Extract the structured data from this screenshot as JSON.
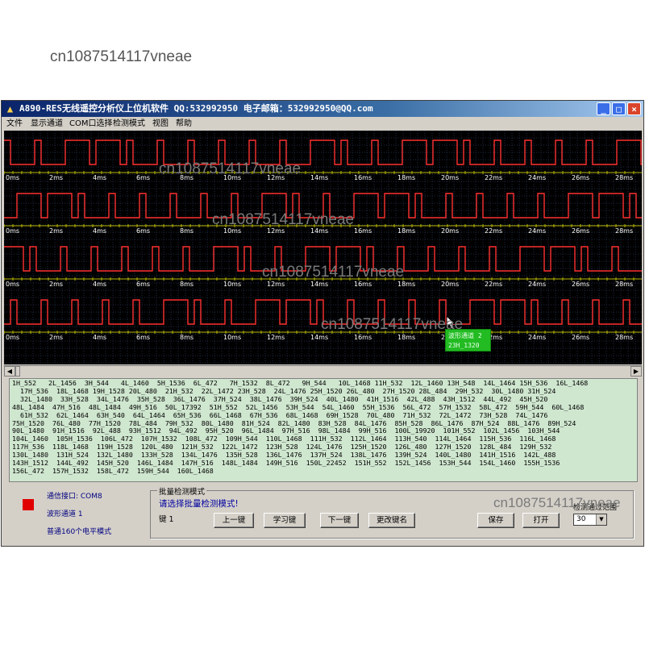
{
  "watermark": "cn1087514117vneae",
  "window": {
    "title": "A890-RES无线遥控分析仪上位机软件 QQ:532992950 电子邮箱：532992950@QQ.com"
  },
  "menu": [
    "文件",
    "显示通道",
    "COM口选择",
    "检测模式",
    "视图",
    "帮助"
  ],
  "scope": {
    "time_labels": [
      "0ms",
      "2ms",
      "4ms",
      "6ms",
      "8ms",
      "10ms",
      "12ms",
      "14ms",
      "16ms",
      "18ms",
      "20ms",
      "22ms",
      "24ms",
      "26ms",
      "28ms"
    ],
    "trace_color": "#ff3030",
    "tooltip": {
      "line1": "波形通道 2",
      "line2": "23H_1320"
    }
  },
  "codes": [
    "1H_552   2L_1456  3H_544   4L_1460  5H_1536  6L_472   7H_1532  8L_472   9H_544   10L_1468 11H_532  12L_1460 13H_548  14L_1464 15H_536  16L_1468",
    "  17H_536  18L_1468 19H_1528 20L_480  21H_532  22L_1472 23H_528  24L_1476 25H_1520 26L_480  27H_1520 28L_484  29H_532  30L_1480 31H_524",
    "  32L_1480  33H_528  34L_1476  35H_528  36L_1476  37H_524  38L_1476  39H_524  40L_1480  41H_1516  42L_488  43H_1512  44L_492  45H_520",
    "48L_1484  47H_516  48L_1484  49H_516  50L_17392  51H_552  52L_1456  53H_544  54L_1460  55H_1536  56L_472  57H_1532  58L_472  59H_544  60L_1468",
    "  61H_532  62L_1464  63H_540  64L_1464  65H_536  66L_1468  67H_536  68L_1468  69H_1528  70L_480  71H_532  72L_1472  73H_528  74L_1476",
    "75H_1520  76L_480  77H_1520  78L_484  79H_532  80L_1480  81H_524  82L_1480  83H_528  84L_1476  85H_528  86L_1476  87H_524  88L_1476  89H_524",
    "90L_1480  91H_1516  92L_488  93H_1512  94L_492  95H_520  96L_1484  97H_516  98L_1484  99H_516  100L_19920  101H_552  102L_1456  103H_544",
    "104L_1460  105H_1536  106L_472  107H_1532  108L_472  109H_544  110L_1468  111H_532  112L_1464  113H_540  114L_1464  115H_536  116L_1468",
    "117H_536  118L_1468  119H_1528  120L_480  121H_532  122L_1472  123H_528  124L_1476  125H_1520  126L_480  127H_1520  128L_484  129H_532",
    "130L_1480  131H_524  132L_1480  133H_528  134L_1476  135H_528  136L_1476  137H_524  138L_1476  139H_524  140L_1480  141H_1516  142L_488",
    "143H_1512  144L_492  145H_520  146L_1484  147H_516  148L_1484  149H_516  150L_22452  151H_552  152L_1456  153H_544  154L_1460  155H_1536",
    "156L_472  157H_1532  158L_472  159H_544  160L_1468"
  ],
  "status": {
    "port": "通信接口: COM8",
    "channel": "波形通道 1",
    "mode": "普通160个电平模式",
    "led_color": "#e00000"
  },
  "batch": {
    "title": "批量检测模式",
    "prompt": "请选择批量检测模式!",
    "key_label": "键 1",
    "buttons": {
      "prev": "上一键",
      "learn": "学习键",
      "next": "下一键",
      "rename": "更改键名",
      "save": "保存",
      "open": "打开"
    },
    "range_label": "检测通过范围",
    "range_value": "30"
  }
}
